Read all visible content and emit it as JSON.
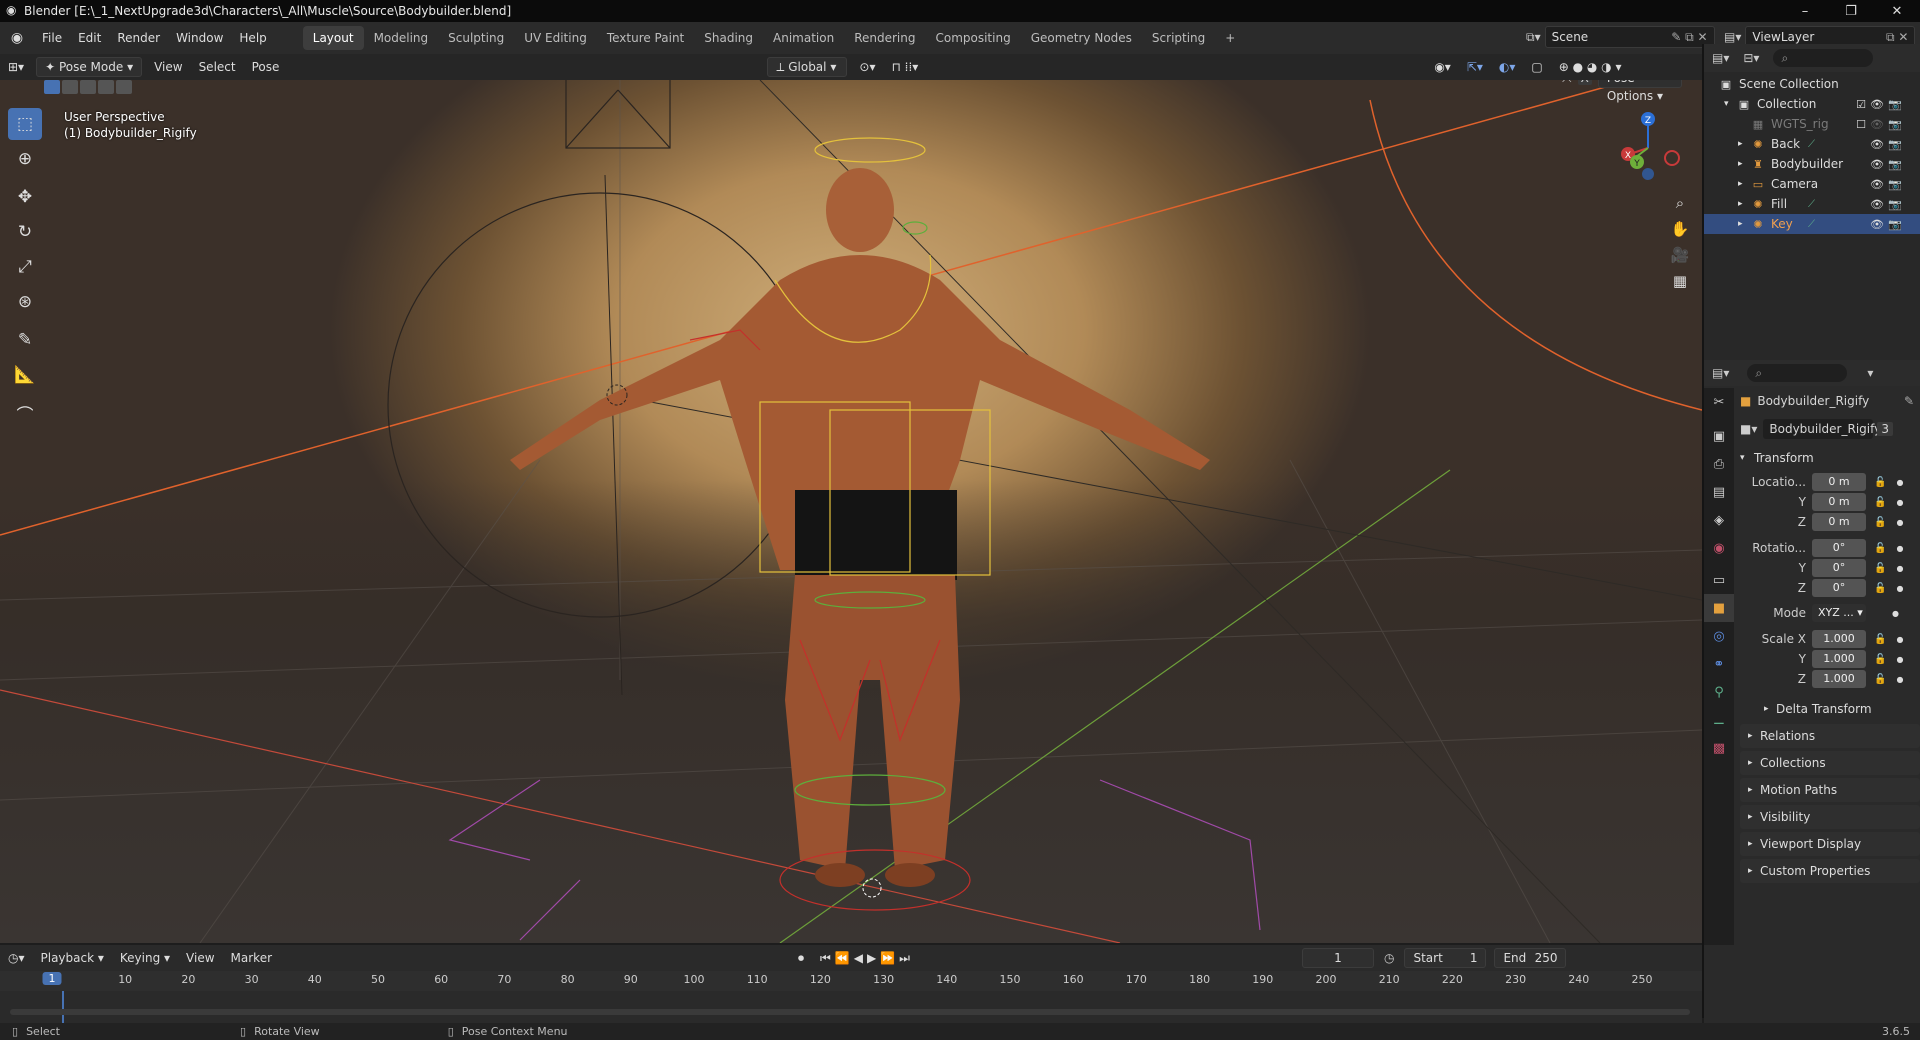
{
  "window": {
    "title": "Blender [E:\\_1_NextUpgrade3d\\Characters\\_All\\Muscle\\Source\\Bodybuilder.blend]",
    "controls": [
      "–",
      "❐",
      "✕"
    ]
  },
  "menu": {
    "items": [
      "File",
      "Edit",
      "Render",
      "Window",
      "Help"
    ],
    "workspaces": [
      "Layout",
      "Modeling",
      "Sculpting",
      "UV Editing",
      "Texture Paint",
      "Shading",
      "Animation",
      "Rendering",
      "Compositing",
      "Geometry Nodes",
      "Scripting"
    ],
    "active_workspace": "Layout",
    "add_tab": "+",
    "scene": "Scene",
    "view_layer": "ViewLayer"
  },
  "viewport_header": {
    "mode": "Pose Mode",
    "menus": [
      "View",
      "Select",
      "Pose"
    ],
    "orientation": "Global",
    "pose_options": "Pose Options"
  },
  "viewport": {
    "perspective": "User Perspective",
    "object": "(1) Bodybuilder_Rigify",
    "gizmo": {
      "x": "X",
      "y": "Y",
      "z": "Z"
    }
  },
  "outliner": {
    "root": "Scene Collection",
    "collection": "Collection",
    "items": [
      {
        "name": "WGTS_rig",
        "dim": true
      },
      {
        "name": "Back"
      },
      {
        "name": "Bodybuilder"
      },
      {
        "name": "Camera"
      },
      {
        "name": "Fill"
      },
      {
        "name": "Key",
        "selected": true
      }
    ]
  },
  "properties": {
    "object_name": "Bodybuilder_Rigify",
    "data_name": "Bodybuilder_Rigify",
    "users": "3",
    "transform_label": "Transform",
    "location": {
      "label": "Locatio...",
      "x": "0 m",
      "y": "0 m",
      "z": "0 m"
    },
    "rotation": {
      "label": "Rotatio...",
      "x": "0°",
      "y": "0°",
      "z": "0°"
    },
    "mode": {
      "label": "Mode",
      "value": "XYZ ..."
    },
    "scale": {
      "label": "Scale X",
      "x": "1.000",
      "y": "1.000",
      "z": "1.000"
    },
    "axis": {
      "y": "Y",
      "z": "Z"
    },
    "delta": "Delta Transform",
    "panels": [
      "Relations",
      "Collections",
      "Motion Paths",
      "Visibility",
      "Viewport Display",
      "Custom Properties"
    ]
  },
  "timeline": {
    "menus": [
      "Playback",
      "Keying",
      "View",
      "Marker"
    ],
    "current_frame": "1",
    "start_label": "Start",
    "start": "1",
    "end_label": "End",
    "end": "250",
    "ticks": [
      "10",
      "20",
      "30",
      "40",
      "50",
      "60",
      "70",
      "80",
      "90",
      "100",
      "110",
      "120",
      "130",
      "140",
      "150",
      "160",
      "170",
      "180",
      "190",
      "200",
      "210",
      "220",
      "230",
      "240",
      "250"
    ],
    "playhead": "1"
  },
  "status": {
    "select": "Select",
    "rotate": "Rotate View",
    "context": "Pose Context Menu",
    "version": "3.6.5"
  },
  "colors": {
    "accent": "#4772b3",
    "selected_row": "#334d80",
    "rig_yellow": "#e4c13c",
    "rig_red": "#c4302b",
    "rig_green": "#5dae3c",
    "skin": "#a55a32"
  }
}
